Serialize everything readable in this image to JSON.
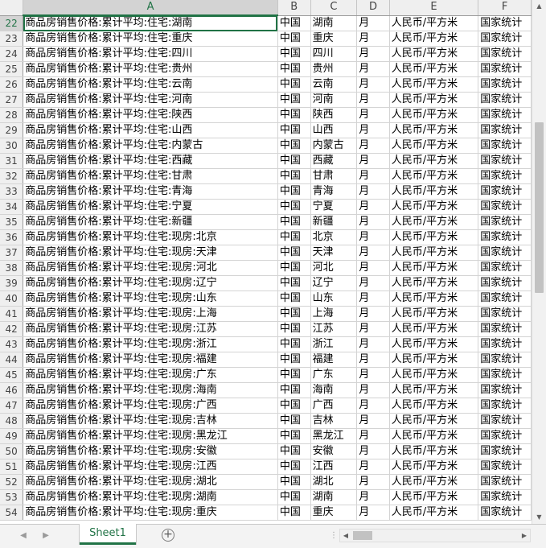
{
  "columns": [
    "A",
    "B",
    "C",
    "D",
    "E",
    "F"
  ],
  "rows": [
    {
      "num": "22",
      "a": "商品房销售价格:累计平均:住宅:湖南",
      "b": "中国",
      "c": "湖南",
      "d": "月",
      "e": "人民币/平方米",
      "f": "国家统计"
    },
    {
      "num": "23",
      "a": "商品房销售价格:累计平均:住宅:重庆",
      "b": "中国",
      "c": "重庆",
      "d": "月",
      "e": "人民币/平方米",
      "f": "国家统计"
    },
    {
      "num": "24",
      "a": "商品房销售价格:累计平均:住宅:四川",
      "b": "中国",
      "c": "四川",
      "d": "月",
      "e": "人民币/平方米",
      "f": "国家统计"
    },
    {
      "num": "25",
      "a": "商品房销售价格:累计平均:住宅:贵州",
      "b": "中国",
      "c": "贵州",
      "d": "月",
      "e": "人民币/平方米",
      "f": "国家统计"
    },
    {
      "num": "26",
      "a": "商品房销售价格:累计平均:住宅:云南",
      "b": "中国",
      "c": "云南",
      "d": "月",
      "e": "人民币/平方米",
      "f": "国家统计"
    },
    {
      "num": "27",
      "a": "商品房销售价格:累计平均:住宅:河南",
      "b": "中国",
      "c": "河南",
      "d": "月",
      "e": "人民币/平方米",
      "f": "国家统计"
    },
    {
      "num": "28",
      "a": "商品房销售价格:累计平均:住宅:陕西",
      "b": "中国",
      "c": "陕西",
      "d": "月",
      "e": "人民币/平方米",
      "f": "国家统计"
    },
    {
      "num": "29",
      "a": "商品房销售价格:累计平均:住宅:山西",
      "b": "中国",
      "c": "山西",
      "d": "月",
      "e": "人民币/平方米",
      "f": "国家统计"
    },
    {
      "num": "30",
      "a": "商品房销售价格:累计平均:住宅:内蒙古",
      "b": "中国",
      "c": "内蒙古",
      "d": "月",
      "e": "人民币/平方米",
      "f": "国家统计"
    },
    {
      "num": "31",
      "a": "商品房销售价格:累计平均:住宅:西藏",
      "b": "中国",
      "c": "西藏",
      "d": "月",
      "e": "人民币/平方米",
      "f": "国家统计"
    },
    {
      "num": "32",
      "a": "商品房销售价格:累计平均:住宅:甘肃",
      "b": "中国",
      "c": "甘肃",
      "d": "月",
      "e": "人民币/平方米",
      "f": "国家统计"
    },
    {
      "num": "33",
      "a": "商品房销售价格:累计平均:住宅:青海",
      "b": "中国",
      "c": "青海",
      "d": "月",
      "e": "人民币/平方米",
      "f": "国家统计"
    },
    {
      "num": "34",
      "a": "商品房销售价格:累计平均:住宅:宁夏",
      "b": "中国",
      "c": "宁夏",
      "d": "月",
      "e": "人民币/平方米",
      "f": "国家统计"
    },
    {
      "num": "35",
      "a": "商品房销售价格:累计平均:住宅:新疆",
      "b": "中国",
      "c": "新疆",
      "d": "月",
      "e": "人民币/平方米",
      "f": "国家统计"
    },
    {
      "num": "36",
      "a": "商品房销售价格:累计平均:住宅:现房:北京",
      "b": "中国",
      "c": "北京",
      "d": "月",
      "e": "人民币/平方米",
      "f": "国家统计"
    },
    {
      "num": "37",
      "a": "商品房销售价格:累计平均:住宅:现房:天津",
      "b": "中国",
      "c": "天津",
      "d": "月",
      "e": "人民币/平方米",
      "f": "国家统计"
    },
    {
      "num": "38",
      "a": "商品房销售价格:累计平均:住宅:现房:河北",
      "b": "中国",
      "c": "河北",
      "d": "月",
      "e": "人民币/平方米",
      "f": "国家统计"
    },
    {
      "num": "39",
      "a": "商品房销售价格:累计平均:住宅:现房:辽宁",
      "b": "中国",
      "c": "辽宁",
      "d": "月",
      "e": "人民币/平方米",
      "f": "国家统计"
    },
    {
      "num": "40",
      "a": "商品房销售价格:累计平均:住宅:现房:山东",
      "b": "中国",
      "c": "山东",
      "d": "月",
      "e": "人民币/平方米",
      "f": "国家统计"
    },
    {
      "num": "41",
      "a": "商品房销售价格:累计平均:住宅:现房:上海",
      "b": "中国",
      "c": "上海",
      "d": "月",
      "e": "人民币/平方米",
      "f": "国家统计"
    },
    {
      "num": "42",
      "a": "商品房销售价格:累计平均:住宅:现房:江苏",
      "b": "中国",
      "c": "江苏",
      "d": "月",
      "e": "人民币/平方米",
      "f": "国家统计"
    },
    {
      "num": "43",
      "a": "商品房销售价格:累计平均:住宅:现房:浙江",
      "b": "中国",
      "c": "浙江",
      "d": "月",
      "e": "人民币/平方米",
      "f": "国家统计"
    },
    {
      "num": "44",
      "a": "商品房销售价格:累计平均:住宅:现房:福建",
      "b": "中国",
      "c": "福建",
      "d": "月",
      "e": "人民币/平方米",
      "f": "国家统计"
    },
    {
      "num": "45",
      "a": "商品房销售价格:累计平均:住宅:现房:广东",
      "b": "中国",
      "c": "广东",
      "d": "月",
      "e": "人民币/平方米",
      "f": "国家统计"
    },
    {
      "num": "46",
      "a": "商品房销售价格:累计平均:住宅:现房:海南",
      "b": "中国",
      "c": "海南",
      "d": "月",
      "e": "人民币/平方米",
      "f": "国家统计"
    },
    {
      "num": "47",
      "a": "商品房销售价格:累计平均:住宅:现房:广西",
      "b": "中国",
      "c": "广西",
      "d": "月",
      "e": "人民币/平方米",
      "f": "国家统计"
    },
    {
      "num": "48",
      "a": "商品房销售价格:累计平均:住宅:现房:吉林",
      "b": "中国",
      "c": "吉林",
      "d": "月",
      "e": "人民币/平方米",
      "f": "国家统计"
    },
    {
      "num": "49",
      "a": "商品房销售价格:累计平均:住宅:现房:黑龙江",
      "b": "中国",
      "c": "黑龙江",
      "d": "月",
      "e": "人民币/平方米",
      "f": "国家统计"
    },
    {
      "num": "50",
      "a": "商品房销售价格:累计平均:住宅:现房:安徽",
      "b": "中国",
      "c": "安徽",
      "d": "月",
      "e": "人民币/平方米",
      "f": "国家统计"
    },
    {
      "num": "51",
      "a": "商品房销售价格:累计平均:住宅:现房:江西",
      "b": "中国",
      "c": "江西",
      "d": "月",
      "e": "人民币/平方米",
      "f": "国家统计"
    },
    {
      "num": "52",
      "a": "商品房销售价格:累计平均:住宅:现房:湖北",
      "b": "中国",
      "c": "湖北",
      "d": "月",
      "e": "人民币/平方米",
      "f": "国家统计"
    },
    {
      "num": "53",
      "a": "商品房销售价格:累计平均:住宅:现房:湖南",
      "b": "中国",
      "c": "湖南",
      "d": "月",
      "e": "人民币/平方米",
      "f": "国家统计"
    },
    {
      "num": "54",
      "a": "商品房销售价格:累计平均:住宅:现房:重庆",
      "b": "中国",
      "c": "重庆",
      "d": "月",
      "e": "人民币/平方米",
      "f": "国家统计"
    }
  ],
  "sheet_tabs": [
    {
      "label": "Sheet1"
    }
  ],
  "add_sheet_symbol": "+",
  "icons": {
    "scroll_up": "▲",
    "scroll_down": "▼",
    "scroll_left": "◀",
    "scroll_right": "▶",
    "tab_prev": "◀",
    "tab_next": "▶",
    "divider": "⋮"
  },
  "colors": {
    "accent": "#217346",
    "header_bg": "#efefef",
    "gridline": "#d4d4d4"
  }
}
